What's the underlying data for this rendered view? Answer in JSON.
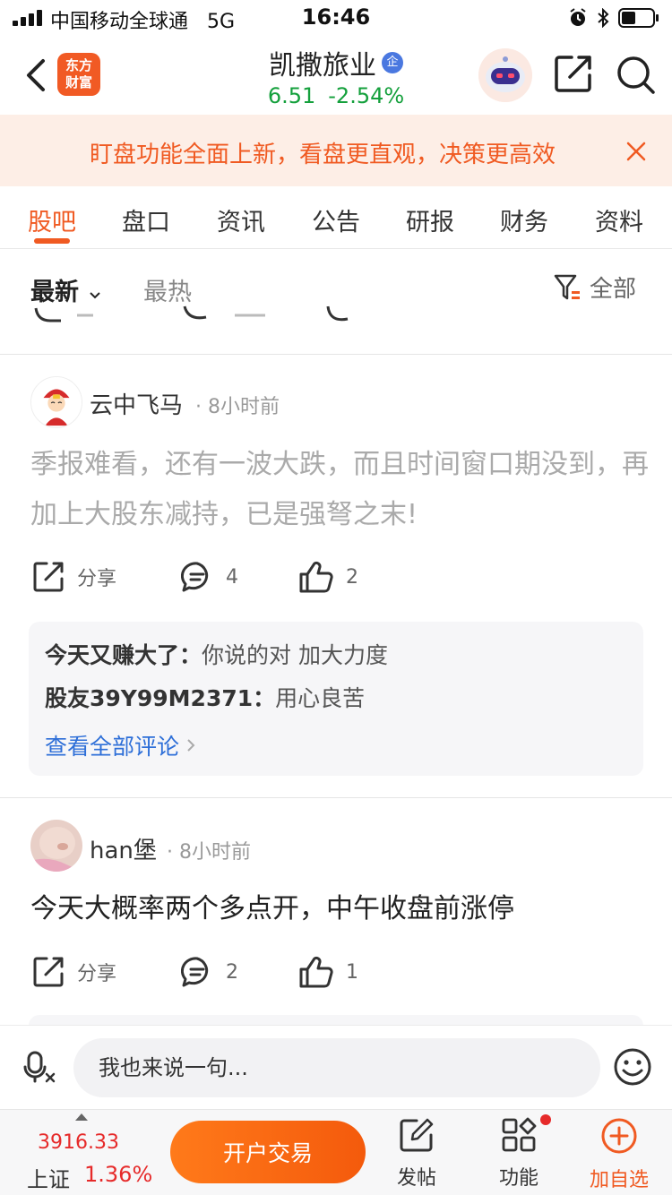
{
  "status_bar": {
    "carrier": "中国移动全球通",
    "network": "5G",
    "time": "16:46"
  },
  "header": {
    "brand": [
      "东方",
      "财富"
    ],
    "stock_name": "凯撒旅业",
    "badge": "企",
    "price": "6.51",
    "change_pct": "-2.54%",
    "icons": [
      "back-icon",
      "robot-avatar",
      "share-icon",
      "search-icon"
    ]
  },
  "banner": {
    "text": "盯盘功能全面上新，看盘更直观，决策更高效"
  },
  "tabs": [
    "股吧",
    "盘口",
    "资讯",
    "公告",
    "研报",
    "财务",
    "资料"
  ],
  "filter": {
    "latest": "最新",
    "hot": "最热",
    "all": "全部"
  },
  "posts": [
    {
      "author": "云中飞马",
      "time": "· 8小时前",
      "body": "季报难看，还有一波大跌，而且时间窗口期没到，再加上大股东减持，已是强弩之末!",
      "share_label": "分享",
      "comments": "4",
      "likes": "2",
      "replies": [
        {
          "user": "今天又赚大了：",
          "text": "你说的对 加大力度"
        },
        {
          "user": "股友39Y99M2371：",
          "text": "用心良苦"
        }
      ],
      "view_all": "查看全部评论"
    },
    {
      "author": "han堡",
      "time": "· 8小时前",
      "body": "今天大概率两个多点开，中午收盘前涨停",
      "share_label": "分享",
      "comments": "2",
      "likes": "1"
    }
  ],
  "input_bar": {
    "placeholder": "我也来说一句..."
  },
  "bottom_bar": {
    "index_value": "3916.33",
    "index_name": "上证",
    "index_change": "1.36%",
    "trade_button": "开户交易",
    "post_label": "发帖",
    "function_label": "功能",
    "add_watch_label": "加自选"
  },
  "colors": {
    "accent": "#f05a22",
    "down_green": "#14a03c",
    "up_red": "#e62a2a",
    "link_blue": "#2e6fd8"
  }
}
